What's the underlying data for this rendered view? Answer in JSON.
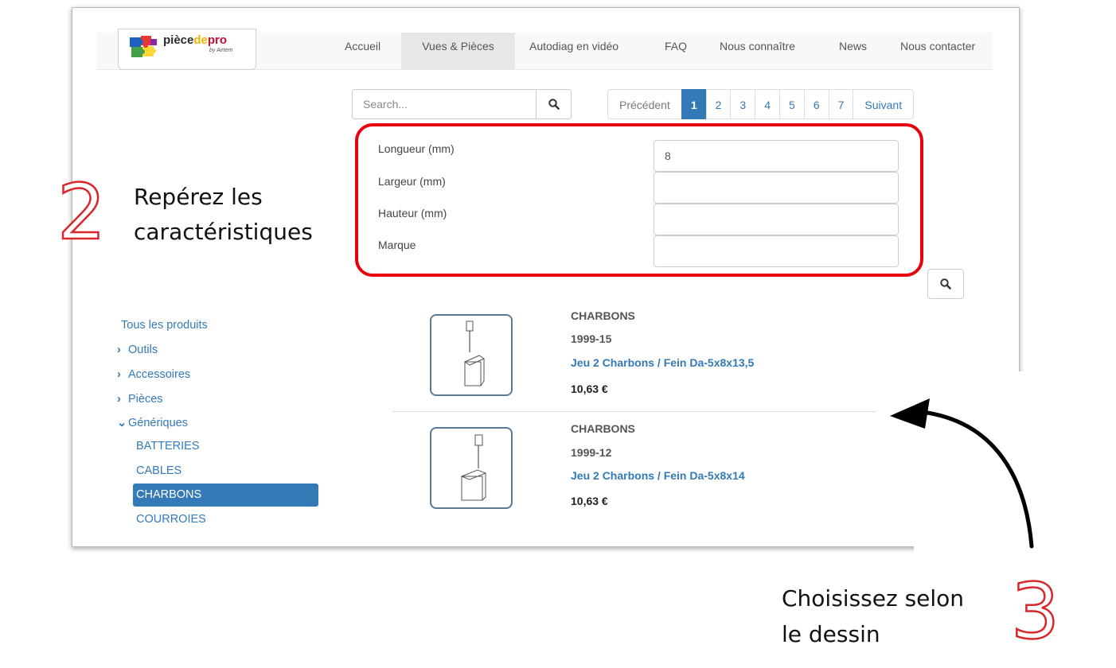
{
  "logo": {
    "brand_1": "pièce",
    "brand_2": "de",
    "brand_3": "pro",
    "sub": "by Airtem"
  },
  "nav": [
    "Accueil",
    "Vues & Pièces",
    "Autodiag en vidéo",
    "FAQ",
    "Nous connaître",
    "News",
    "Nous contacter"
  ],
  "search": {
    "placeholder": "Search..."
  },
  "pagination": {
    "prev": "Précédent",
    "pages": [
      "1",
      "2",
      "3",
      "4",
      "5",
      "6",
      "7"
    ],
    "next": "Suivant",
    "current": "1"
  },
  "filters": {
    "length": {
      "label": "Longueur (mm)",
      "value": "8"
    },
    "width": {
      "label": "Largeur (mm)",
      "value": ""
    },
    "height": {
      "label": "Hauteur (mm)",
      "value": ""
    },
    "brand": {
      "label": "Marque",
      "value": ""
    }
  },
  "sidebar": {
    "all": "Tous les produits",
    "categories": [
      "Outils",
      "Accessoires",
      "Pièces",
      "Génériques"
    ],
    "sub": [
      "BATTERIES",
      "CABLES",
      "CHARBONS",
      "COURROIES"
    ]
  },
  "products": [
    {
      "category": "CHARBONS",
      "ref": "1999-15",
      "name": "Jeu 2 Charbons / Fein Da-5x8x13,5",
      "price": "10,63 €"
    },
    {
      "category": "CHARBONS",
      "ref": "1999-12",
      "name": "Jeu 2 Charbons / Fein Da-5x8x14",
      "price": "10,63 €"
    }
  ],
  "annotations": {
    "step2": {
      "number": "2",
      "line1": "Repérez les",
      "line2": "caractéristiques"
    },
    "step3": {
      "number": "3",
      "line1": "Choisissez selon",
      "line2": "le dessin"
    }
  },
  "colors": {
    "accent": "#337ab7",
    "highlight": "#e8000d",
    "annotation_number": "#d9262b"
  }
}
